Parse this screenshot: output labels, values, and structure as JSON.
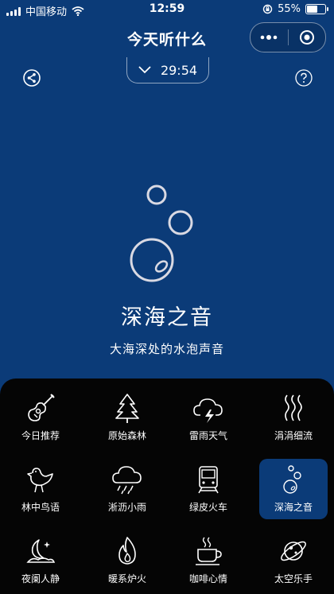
{
  "status_bar": {
    "carrier": "中国移动",
    "time": "12:59",
    "battery": "55%"
  },
  "header": {
    "title": "今天听什么"
  },
  "timer": {
    "value": "29:54"
  },
  "hero": {
    "title": "深海之音",
    "subtitle": "大海深处的水泡声音"
  },
  "sounds": [
    {
      "label": "今日推荐",
      "icon": "guitar-icon"
    },
    {
      "label": "原始森林",
      "icon": "tree-icon"
    },
    {
      "label": "雷雨天气",
      "icon": "thunder-cloud-icon"
    },
    {
      "label": "涓涓细流",
      "icon": "stream-icon"
    },
    {
      "label": "林中鸟语",
      "icon": "bird-icon"
    },
    {
      "label": "淅沥小雨",
      "icon": "rain-cloud-icon"
    },
    {
      "label": "绿皮火车",
      "icon": "train-icon"
    },
    {
      "label": "深海之音",
      "icon": "bubbles-icon",
      "active": true
    },
    {
      "label": "夜阑人静",
      "icon": "moon-icon"
    },
    {
      "label": "暖系炉火",
      "icon": "fire-icon"
    },
    {
      "label": "咖啡心情",
      "icon": "coffee-icon"
    },
    {
      "label": "太空乐手",
      "icon": "planet-icon"
    }
  ],
  "colors": {
    "background": "#0b3b78",
    "panel": "#050505",
    "active_tile": "#0b3b78"
  }
}
